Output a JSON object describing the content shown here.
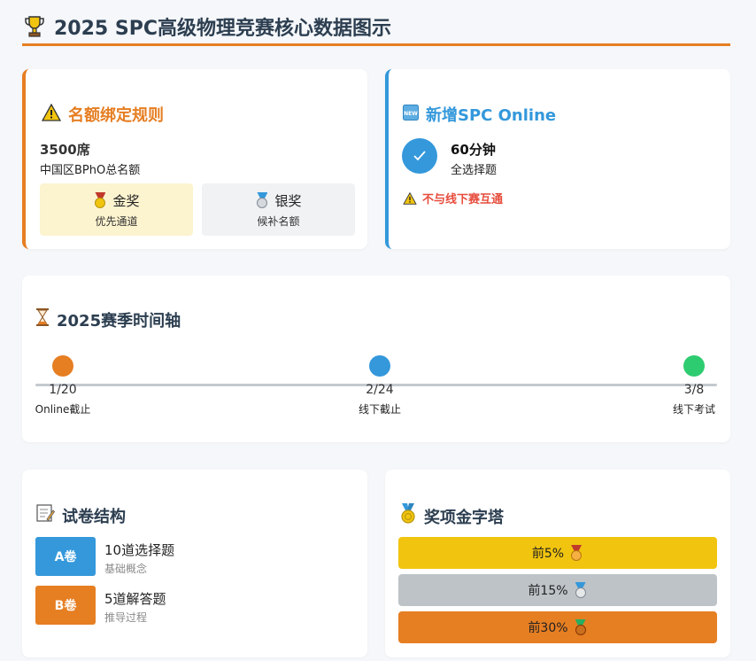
{
  "header": {
    "title": "2025 SPC高级物理竞赛核心数据图示",
    "icon": "trophy-icon"
  },
  "quota_card": {
    "title": "名额绑定规则",
    "count": "3500席",
    "desc": "中国区BPhO总名额",
    "gold": {
      "label": "金奖",
      "sub": "优先通道"
    },
    "silver": {
      "label": "银奖",
      "sub": "候补名额"
    }
  },
  "online_card": {
    "title": "新增SPC Online",
    "duration": "60分钟",
    "format": "全选择题",
    "warning": "不与线下赛互通"
  },
  "timeline": {
    "title": "2025赛季时间轴",
    "events": [
      {
        "date": "1/20",
        "label": "Online截止",
        "color": "#e67e22"
      },
      {
        "date": "2/24",
        "label": "线下截止",
        "color": "#3498db"
      },
      {
        "date": "3/8",
        "label": "线下考试",
        "color": "#2ecc71"
      }
    ]
  },
  "paper": {
    "title": "试卷结构",
    "parts": [
      {
        "tag": "A卷",
        "main": "10道选择题",
        "sub": "基础概念",
        "color": "#3498db"
      },
      {
        "tag": "B卷",
        "main": "5道解答题",
        "sub": "推导过程",
        "color": "#e67e22"
      }
    ]
  },
  "pyramid": {
    "title": "奖项金字塔",
    "tiers": [
      {
        "label": "前5%",
        "color": "#f1c40f"
      },
      {
        "label": "前15%",
        "color": "#bdc3c7"
      },
      {
        "label": "前30%",
        "color": "#e67e22"
      }
    ]
  },
  "colors": {
    "accent": "#e67e22",
    "blue": "#3498db",
    "danger": "#e74c3c",
    "text": "#2c3e50"
  }
}
